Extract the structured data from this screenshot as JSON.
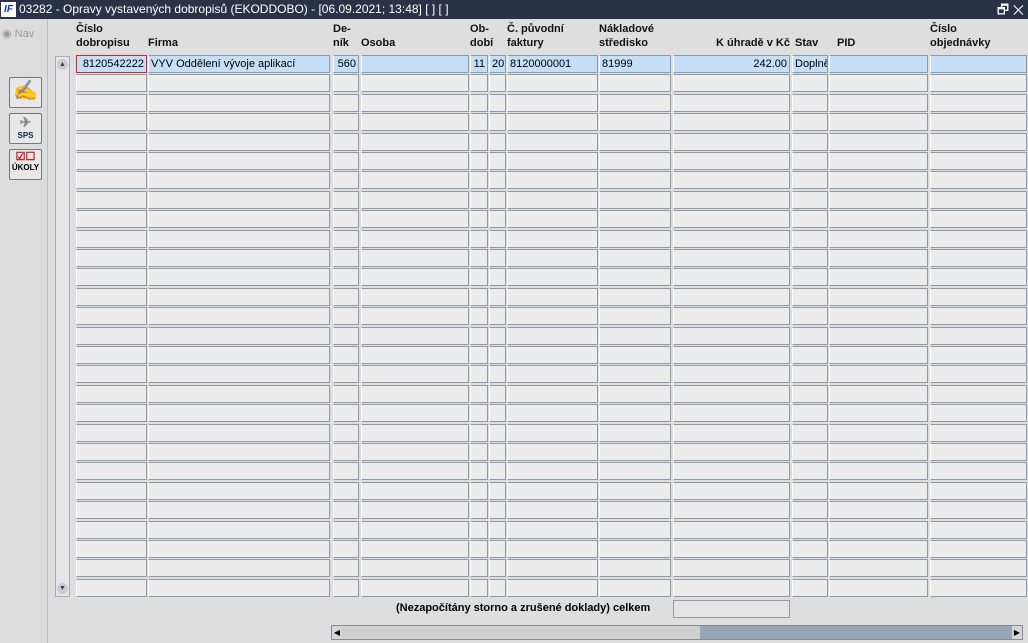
{
  "window": {
    "title": "03282 - Opravy vystavených dobropisů (EKODDOBO) - [06.09.2021; 13:48]  [ ]  [ ]",
    "logo": "IF",
    "restore_icon": "🗗",
    "close_icon": "✕"
  },
  "sidebar": {
    "nav_label": "Nav",
    "sps_label": "SPS",
    "ukoly_label": "ÚKOLY"
  },
  "columns": [
    {
      "l1": "Číslo",
      "l2": "dobropisu"
    },
    {
      "l1": "",
      "l2": "Firma"
    },
    {
      "l1": "De-",
      "l2": "ník"
    },
    {
      "l1": "",
      "l2": "Osoba"
    },
    {
      "l1": "Ob-",
      "l2": "dobí"
    },
    {
      "l1": "Č. původní",
      "l2": "faktury"
    },
    {
      "l1": "Nákladové",
      "l2": "středisko"
    },
    {
      "l1": "",
      "l2": "K úhradě v Kč"
    },
    {
      "l1": "",
      "l2": "Stav"
    },
    {
      "l1": "",
      "l2": "PID"
    },
    {
      "l1": "Číslo",
      "l2": "objednávky"
    }
  ],
  "rows": [
    [
      "8120542222",
      "VYV Oddělení vývoje aplikací",
      "560",
      "",
      "11",
      "20",
      "8120000001",
      "81999",
      "242.00",
      "Doplně",
      "",
      ""
    ]
  ],
  "footer": {
    "total_label": "(Nezapočítány storno a zrušené doklady) celkem",
    "total_value": ""
  }
}
